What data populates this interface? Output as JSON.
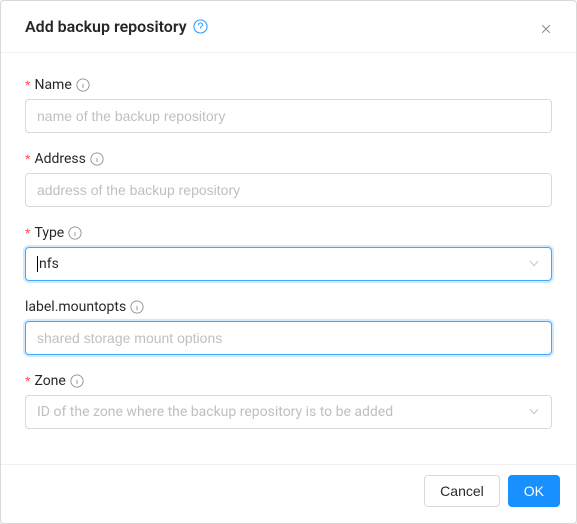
{
  "modal": {
    "title": "Add backup repository"
  },
  "form": {
    "name": {
      "label": "Name",
      "required": true,
      "placeholder": "name of the backup repository",
      "value": ""
    },
    "address": {
      "label": "Address",
      "required": true,
      "placeholder": "address of the backup repository",
      "value": ""
    },
    "type": {
      "label": "Type",
      "required": true,
      "value": "nfs"
    },
    "mountopts": {
      "label": "label.mountopts",
      "required": false,
      "placeholder": "shared storage mount options",
      "value": ""
    },
    "zone": {
      "label": "Zone",
      "required": true,
      "placeholder": "ID of the zone where the backup repository is to be added",
      "value": ""
    }
  },
  "footer": {
    "cancel": "Cancel",
    "ok": "OK"
  },
  "required_mark": "*"
}
